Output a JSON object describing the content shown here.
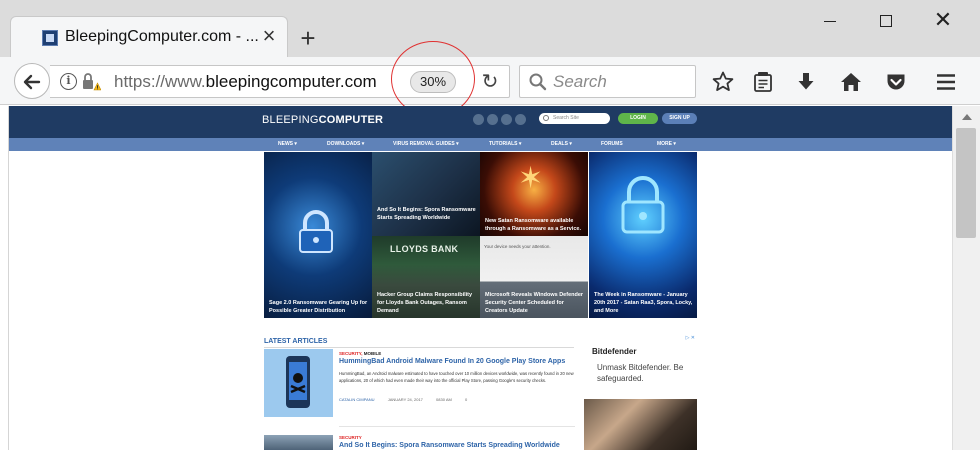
{
  "browser": {
    "tab_title": "BleepingComputer.com - ...",
    "new_tab": "+",
    "tab_close": "×",
    "window_close": "✕",
    "url_prefix": "https://www.",
    "url_domain": "bleepingcomputer.com",
    "zoom": "30%",
    "search_placeholder": "Search",
    "back_glyph": "🡐",
    "reload_glyph": "↻",
    "annotation_color": "#e03131"
  },
  "site": {
    "logo_light": "BLEEPING",
    "logo_bold": "COMPUTER",
    "search_placeholder": "Search Site",
    "login": "LOGIN",
    "signup": "SIGN UP",
    "nav": [
      "NEWS ▾",
      "DOWNLOADS ▾",
      "VIRUS REMOVAL GUIDES ▾",
      "TUTORIALS ▾",
      "DEALS ▾",
      "FORUMS",
      "MORE ▾"
    ],
    "header_color": "#1f3b63",
    "nav_color": "#5f82b8"
  },
  "hero": {
    "h1": "Sage 2.0 Ransomware Gearing Up for Possible Greater Distribution",
    "h2": "And So It Begins: Spora Ransomware Starts Spreading Worldwide",
    "h3": "New Satan Ransomware available through a Ransomware as a Service.",
    "h4": "The Week in Ransomware - January 20th 2017 - Satan Raa3, Spora, Locky, and More",
    "h5": "Hacker Group Claims Responsibility for Lloyds Bank Outages, Ransom Demand",
    "h5_sign": "LLOYDS BANK",
    "h6": "Microsoft Reveals Windows Defender Security Center Scheduled for Creators Update",
    "h6_note": "Your device needs your attention."
  },
  "latest": {
    "heading": "LATEST ARTICLES",
    "article1": {
      "tag1": "SECURITY,",
      "tag2": " MOBILE",
      "title": "HummingBad Android Malware Found In 20 Google Play Store Apps",
      "excerpt": "HummingBad, an Android malware estimated to have touched over 10 million devices worldwide, was recently found in 20 new applications, 20 of which had even made their way into the official Play Store, passing Google's security checks.",
      "author": "CATALIN CIMPANU",
      "date": "JANUARY 24, 2017",
      "reads": "0830 AM",
      "comments": "0"
    },
    "article2": {
      "tag": "SECURITY",
      "title": "And So It Begins: Spora Ransomware Starts Spreading Worldwide"
    }
  },
  "ad": {
    "brand": "Bitdefender",
    "text": "Unmask Bitdefender. Be safeguarded.",
    "choice": "▷ ✕"
  }
}
